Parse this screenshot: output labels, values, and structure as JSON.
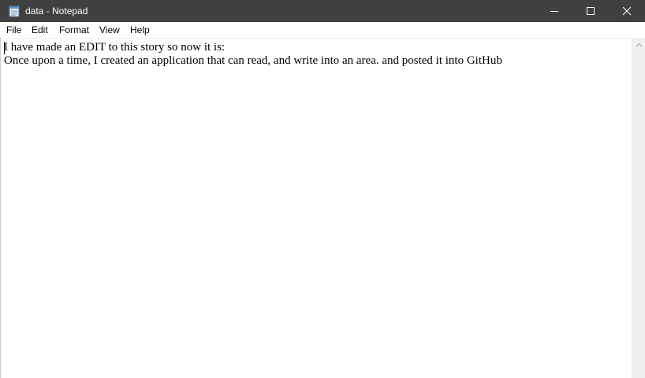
{
  "window": {
    "title": "data - Notepad"
  },
  "titlebar": {
    "icon": "notepad-icon",
    "buttons": [
      "minimize-icon",
      "maximize-icon",
      "close-icon"
    ]
  },
  "menu": {
    "file": "File",
    "edit": "Edit",
    "format": "Format",
    "view": "View",
    "help": "Help"
  },
  "editor": {
    "line1": "I have made an EDIT to this story so now it is:",
    "line2": "Once upon a time, I created an application that can read, and write into an area. and posted it into GitHub"
  },
  "colors": {
    "titlebar_bg": "#404040",
    "titlebar_text": "#ffffff",
    "editor_bg": "#ffffff",
    "scrollbar_bg": "#f0f0f0"
  }
}
